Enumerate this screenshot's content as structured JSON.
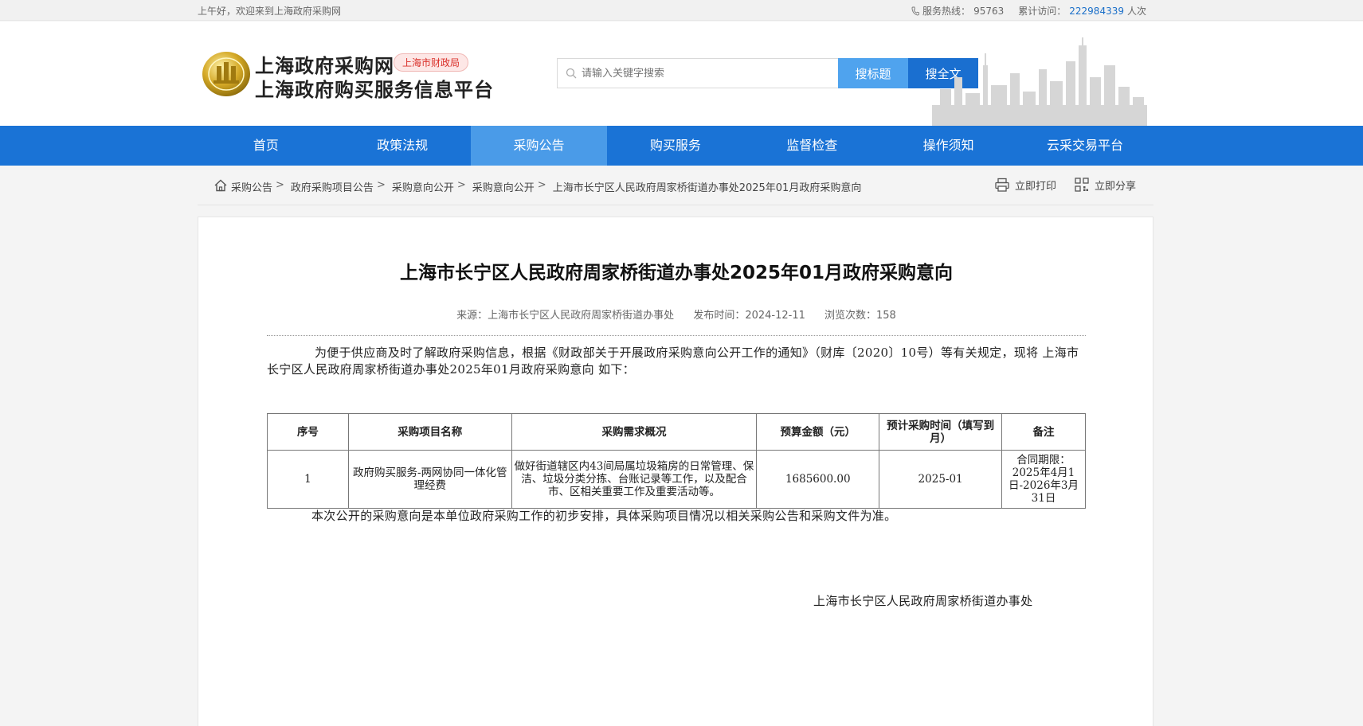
{
  "topbar": {
    "welcome": "上午好，欢迎来到上海政府采购网",
    "hotline_label": "服务热线：",
    "hotline": "95763",
    "visits_label": "累计访问：",
    "visits": "222984339",
    "visits_unit": "人次"
  },
  "header": {
    "site_name": "上海政府采购网",
    "site_sub": "上海政府购买服务信息平台",
    "bureau_tag": "上海市财政局",
    "search_placeholder": "请输入关键字搜索",
    "search_title_btn": "搜标题",
    "search_full_btn": "搜全文"
  },
  "nav": {
    "items": [
      "首页",
      "政策法规",
      "采购公告",
      "购买服务",
      "监督检查",
      "操作须知",
      "云采交易平台"
    ],
    "active_index": 2
  },
  "breadcrumb": {
    "items": [
      "采购公告",
      "政府采购项目公告",
      "采购意向公开",
      "采购意向公开",
      "上海市长宁区人民政府周家桥街道办事处2025年01月政府采购意向"
    ],
    "sep": ">",
    "print_label": "立即打印",
    "share_label": "立即分享"
  },
  "article": {
    "title": "上海市长宁区人民政府周家桥街道办事处2025年01月政府采购意向",
    "source": "来源：上海市长宁区人民政府周家桥街道办事处",
    "publish": "发布时间：2024-12-11",
    "views": "浏览次数：158",
    "intro": "为便于供应商及时了解政府采购信息，根据《财政部关于开展政府采购意向公开工作的通知》（财库〔2020〕10号）等有关规定，现将 上海市长宁区人民政府周家桥街道办事处2025年01月政府采购意向 如下：",
    "table": {
      "headers": [
        "序号",
        "采购项目名称",
        "采购需求概况",
        "预算金额（元）",
        "预计采购时间（填写到月）",
        "备注"
      ],
      "rows": [
        [
          "1",
          "政府购买服务-两网协同一体化管理经费",
          "做好街道辖区内43间局属垃圾箱房的日常管理、保洁、垃圾分类分拣、台账记录等工作，以及配合市、区相关重要工作及重要活动等。",
          "1685600.00",
          "2025-01",
          "合同期限：2025年4月1日-2026年3月31日"
        ]
      ]
    },
    "note": "本次公开的采购意向是本单位政府采购工作的初步安排，具体采购项目情况以相关采购公告和采购文件为准。",
    "signature": "上海市长宁区人民政府周家桥街道办事处"
  },
  "colors": {
    "nav_bg": "#1a73d6",
    "nav_active": "#4a9be8",
    "search_full_btn": "#1a6fd0",
    "search_title_btn": "#4fa3ee",
    "bureau_tag": "#d9302a"
  }
}
